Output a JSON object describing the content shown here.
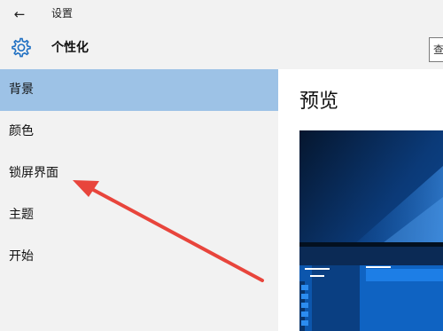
{
  "window": {
    "back_icon": "back-arrow-icon",
    "title": "设置"
  },
  "header": {
    "icon": "gear-icon",
    "title": "个性化",
    "search_fragment": "查"
  },
  "sidebar": {
    "items": [
      {
        "label": "背景",
        "selected": true
      },
      {
        "label": "颜色",
        "selected": false
      },
      {
        "label": "锁屏界面",
        "selected": false
      },
      {
        "label": "主题",
        "selected": false
      },
      {
        "label": "开始",
        "selected": false
      }
    ]
  },
  "main": {
    "heading": "预览"
  },
  "colors": {
    "selected_item": "#9dc2e6",
    "sidebar_bg": "#f2f2f2",
    "accent": "#0078d7",
    "annotation_arrow": "#e8453c"
  }
}
